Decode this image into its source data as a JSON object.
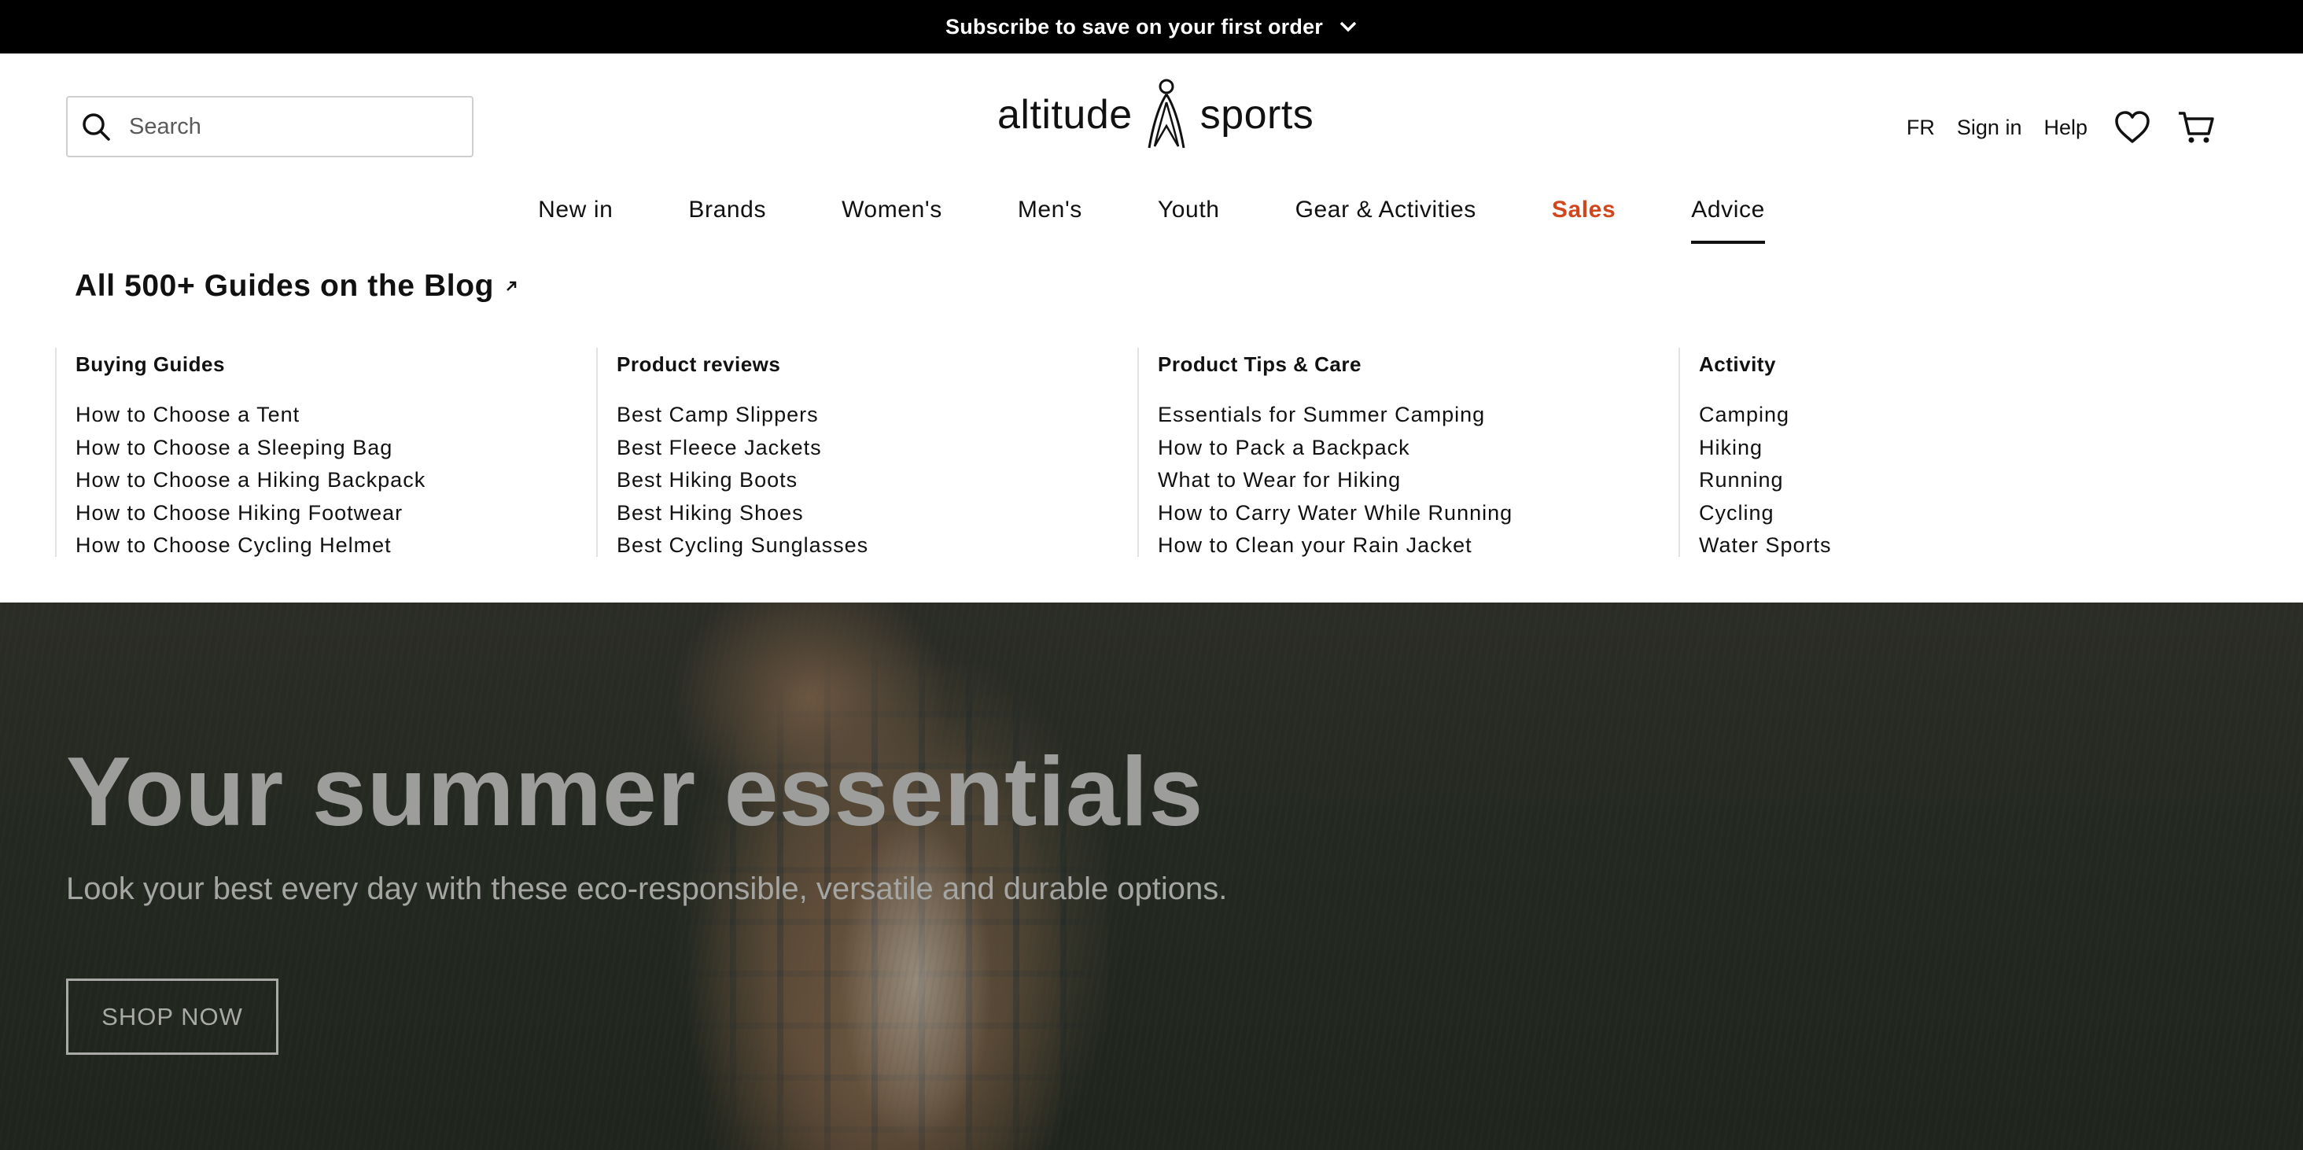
{
  "promo": {
    "text": "Subscribe to save on your first order",
    "icon": "chevron-down-icon"
  },
  "header": {
    "search": {
      "placeholder": "Search",
      "value": "",
      "icon": "search-icon"
    },
    "logo": {
      "left": "altitude",
      "right": "sports"
    },
    "utilities": {
      "language": "FR",
      "sign_in": "Sign in",
      "help": "Help",
      "wishlist_icon": "heart-icon",
      "cart_icon": "cart-icon"
    }
  },
  "nav": {
    "items": [
      {
        "label": "New in"
      },
      {
        "label": "Brands"
      },
      {
        "label": "Women's"
      },
      {
        "label": "Men's"
      },
      {
        "label": "Youth"
      },
      {
        "label": "Gear & Activities"
      },
      {
        "label": "Sales"
      },
      {
        "label": "Advice"
      }
    ],
    "active": "Advice",
    "sale_color": "#d2461b"
  },
  "mega_menu": {
    "blog_link": "All 500+ Guides on the Blog",
    "columns": [
      {
        "title": "Buying Guides",
        "links": [
          "How to Choose a Tent",
          "How to Choose a Sleeping Bag",
          "How to Choose a Hiking Backpack",
          "How to Choose Hiking Footwear",
          "How to Choose Cycling Helmet"
        ]
      },
      {
        "title": "Product reviews",
        "links": [
          "Best Camp Slippers",
          "Best Fleece Jackets",
          "Best Hiking Boots",
          "Best Hiking Shoes",
          "Best Cycling Sunglasses"
        ]
      },
      {
        "title": "Product Tips & Care",
        "links": [
          "Essentials for Summer Camping",
          "How to Pack a Backpack",
          "What to Wear for Hiking",
          "How to Carry Water While Running",
          "How to Clean your Rain Jacket"
        ]
      },
      {
        "title": "Activity",
        "links": [
          "Camping",
          "Hiking",
          "Running",
          "Cycling",
          "Water Sports"
        ]
      }
    ]
  },
  "hero": {
    "title": "Your summer essentials",
    "subtitle": "Look your best every day with these eco-responsible, versatile and durable options.",
    "cta": "SHOP NOW"
  }
}
